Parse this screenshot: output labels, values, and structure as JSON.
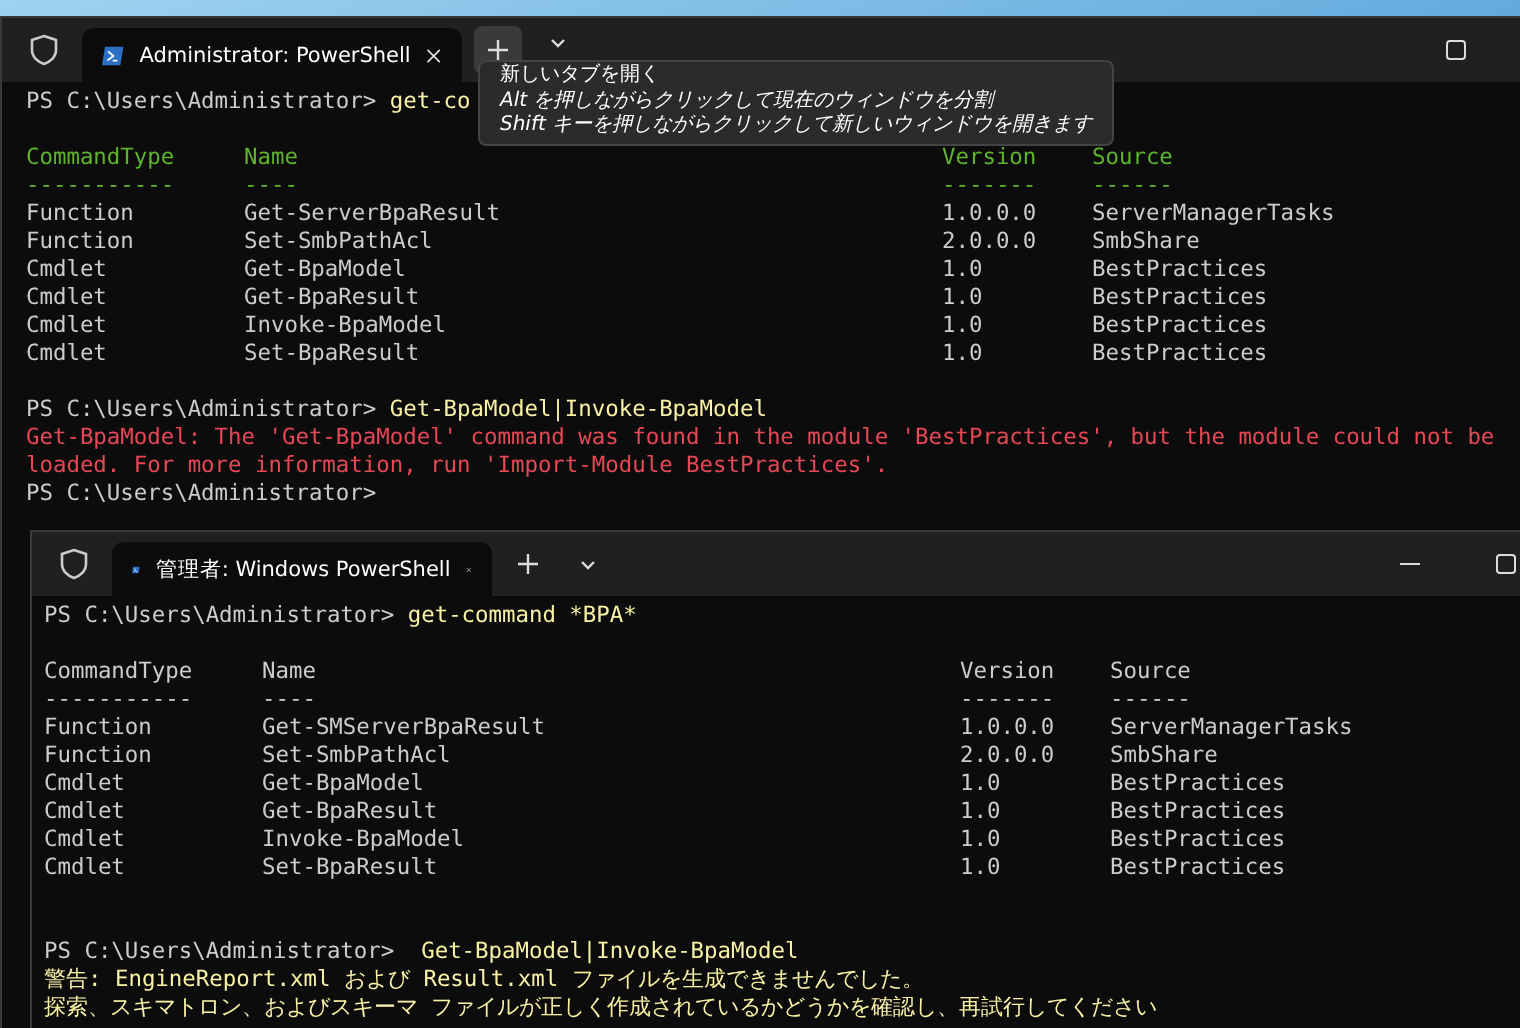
{
  "windows": [
    {
      "tab_title": "Administrator: PowerShell",
      "tooltip": {
        "title": "新しいタブを開く",
        "lines": [
          "Alt を押しながらクリックして現在のウィンドウを分割",
          "Shift キーを押しながらクリックして新しいウィンドウを開きます"
        ]
      },
      "lines": [
        {
          "kind": "command",
          "prompt": "PS C:\\Users\\Administrator> ",
          "command": "get-co"
        },
        {
          "kind": "blank"
        },
        {
          "kind": "table",
          "header_highlighted": true,
          "columns": [
            "CommandType",
            "Name",
            "Version",
            "Source"
          ],
          "underlines": [
            "-----------",
            "----",
            "-------",
            "------"
          ],
          "rows": [
            [
              "Function",
              "Get-ServerBpaResult",
              "1.0.0.0",
              "ServerManagerTasks"
            ],
            [
              "Function",
              "Set-SmbPathAcl",
              "2.0.0.0",
              "SmbShare"
            ],
            [
              "Cmdlet",
              "Get-BpaModel",
              "1.0",
              "BestPractices"
            ],
            [
              "Cmdlet",
              "Get-BpaResult",
              "1.0",
              "BestPractices"
            ],
            [
              "Cmdlet",
              "Invoke-BpaModel",
              "1.0",
              "BestPractices"
            ],
            [
              "Cmdlet",
              "Set-BpaResult",
              "1.0",
              "BestPractices"
            ]
          ]
        },
        {
          "kind": "blank"
        },
        {
          "kind": "command",
          "prompt": "PS C:\\Users\\Administrator> ",
          "command": "Get-BpaModel|Invoke-BpaModel"
        },
        {
          "kind": "error",
          "text": "Get-BpaModel: The 'Get-BpaModel' command was found in the module 'BestPractices', but the module could not be"
        },
        {
          "kind": "error",
          "text": "loaded. For more information, run 'Import-Module BestPractices'."
        },
        {
          "kind": "command",
          "prompt": "PS C:\\Users\\Administrator> "
        }
      ]
    },
    {
      "tab_title": "管理者: Windows PowerShell",
      "lines": [
        {
          "kind": "command",
          "prompt": "PS C:\\Users\\Administrator> ",
          "command": "get-command *BPA*"
        },
        {
          "kind": "blank"
        },
        {
          "kind": "table",
          "header_highlighted": false,
          "columns": [
            "CommandType",
            "Name",
            "Version",
            "Source"
          ],
          "underlines": [
            "-----------",
            "----",
            "-------",
            "------"
          ],
          "rows": [
            [
              "Function",
              "Get-SMServerBpaResult",
              "1.0.0.0",
              "ServerManagerTasks"
            ],
            [
              "Function",
              "Set-SmbPathAcl",
              "2.0.0.0",
              "SmbShare"
            ],
            [
              "Cmdlet",
              "Get-BpaModel",
              "1.0",
              "BestPractices"
            ],
            [
              "Cmdlet",
              "Get-BpaResult",
              "1.0",
              "BestPractices"
            ],
            [
              "Cmdlet",
              "Invoke-BpaModel",
              "1.0",
              "BestPractices"
            ],
            [
              "Cmdlet",
              "Set-BpaResult",
              "1.0",
              "BestPractices"
            ]
          ]
        },
        {
          "kind": "blank"
        },
        {
          "kind": "blank"
        },
        {
          "kind": "command",
          "prompt": "PS C:\\Users\\Administrator> ",
          "command": " Get-BpaModel|Invoke-BpaModel"
        },
        {
          "kind": "warning",
          "text": "警告: EngineReport.xml および Result.xml ファイルを生成できませんでした。"
        },
        {
          "kind": "warning",
          "text": "探索、スキマトロン、およびスキーマ ファイルが正しく作成されているかどうかを確認し、再試行してください"
        }
      ]
    }
  ]
}
